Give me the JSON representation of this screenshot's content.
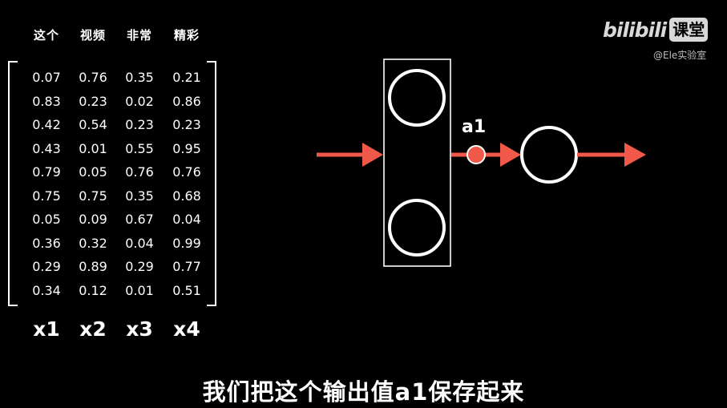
{
  "headers": [
    "这个",
    "视频",
    "非常",
    "精彩"
  ],
  "matrix": [
    [
      "0.07",
      "0.76",
      "0.35",
      "0.21"
    ],
    [
      "0.83",
      "0.23",
      "0.02",
      "0.86"
    ],
    [
      "0.42",
      "0.54",
      "0.23",
      "0.23"
    ],
    [
      "0.43",
      "0.01",
      "0.55",
      "0.95"
    ],
    [
      "0.79",
      "0.05",
      "0.76",
      "0.76"
    ],
    [
      "0.75",
      "0.75",
      "0.35",
      "0.68"
    ],
    [
      "0.05",
      "0.09",
      "0.67",
      "0.04"
    ],
    [
      "0.36",
      "0.32",
      "0.04",
      "0.99"
    ],
    [
      "0.29",
      "0.89",
      "0.29",
      "0.77"
    ],
    [
      "0.34",
      "0.12",
      "0.01",
      "0.51"
    ]
  ],
  "variables": [
    "x1",
    "x2",
    "x3",
    "x4"
  ],
  "logo": {
    "brand": "bilibili",
    "box": "课堂"
  },
  "handle": "@Ele实验室",
  "activation_label": "a1",
  "subtitle": "我们把这个输出值a1保存起来",
  "colors": {
    "arrow": "#f0584a",
    "node": "#ffffff",
    "background": "#000000"
  }
}
